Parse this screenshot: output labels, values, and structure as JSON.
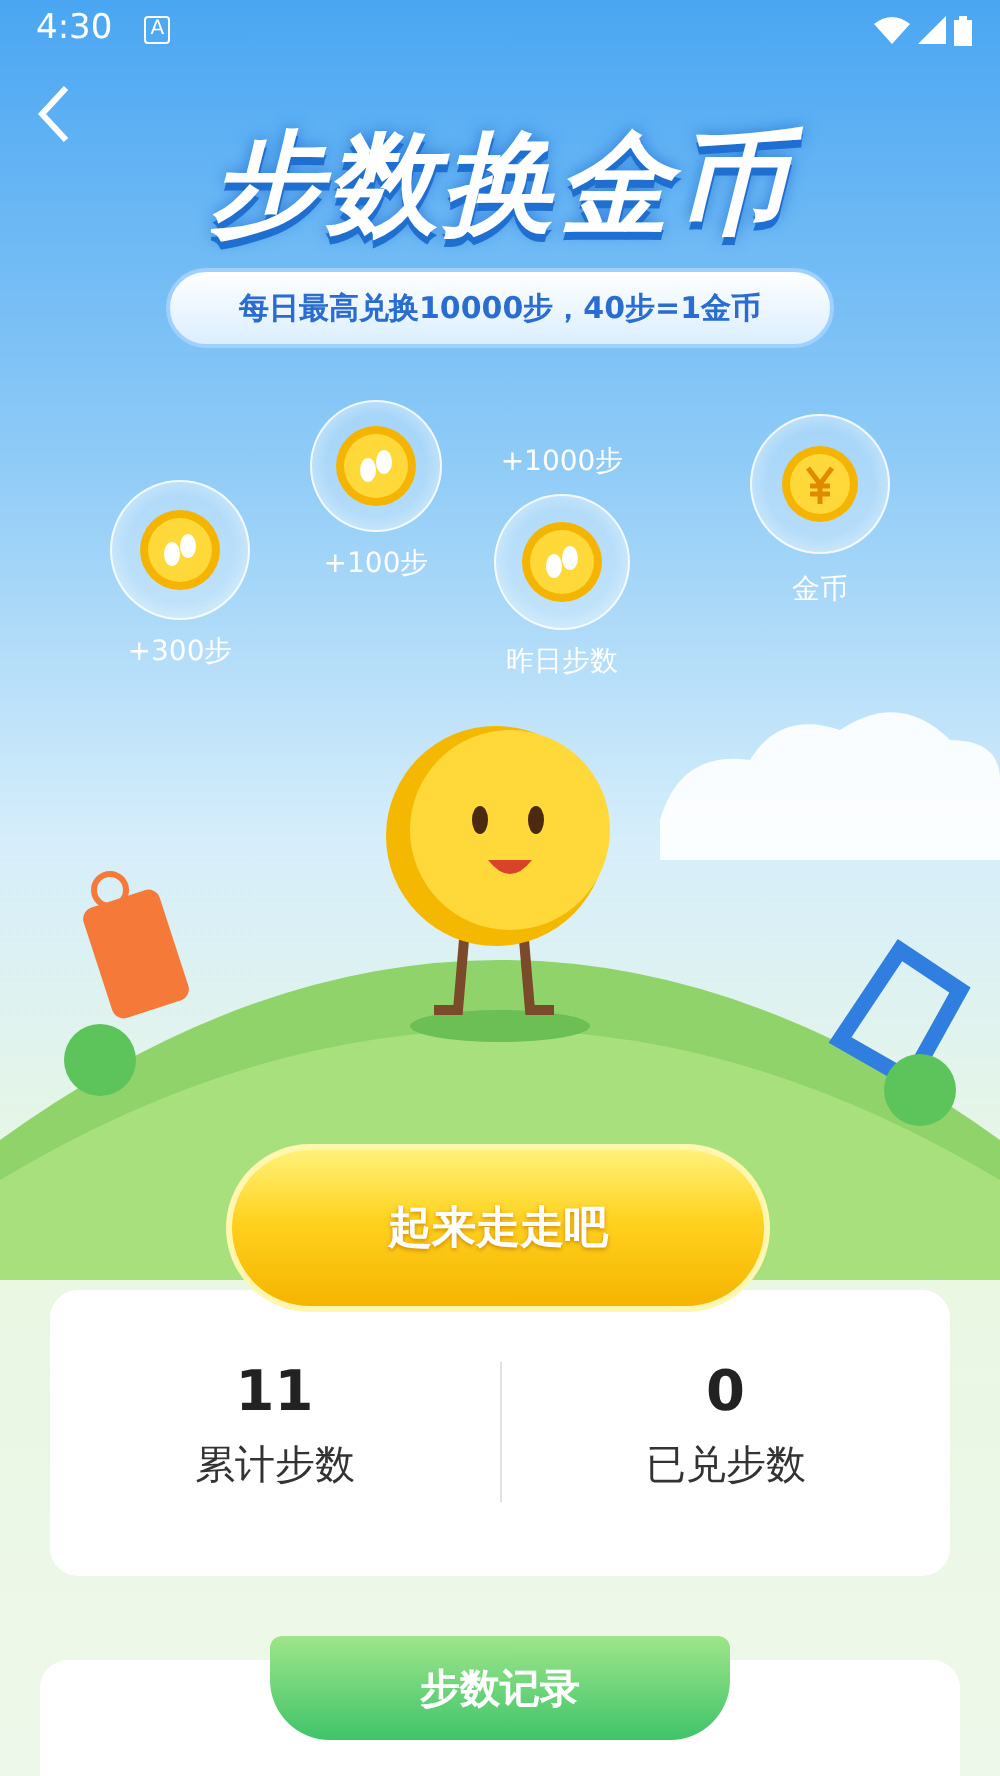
{
  "status_bar": {
    "time": "4:30",
    "badge": "A"
  },
  "header": {
    "title": "步数换金币",
    "subtitle": "每日最高兑换10000步，40步=1金币"
  },
  "bubbles": [
    {
      "kind": "steps",
      "label": "+300步"
    },
    {
      "kind": "steps",
      "label": "+100步"
    },
    {
      "kind": "steps",
      "top_label": "+1000步",
      "label": "昨日步数"
    },
    {
      "kind": "coin",
      "label": "金币"
    }
  ],
  "action_button": "起来走走吧",
  "stats": [
    {
      "value": "11",
      "label": "累计步数"
    },
    {
      "value": "0",
      "label": "已兑步数"
    }
  ],
  "records_tab": "步数记录"
}
